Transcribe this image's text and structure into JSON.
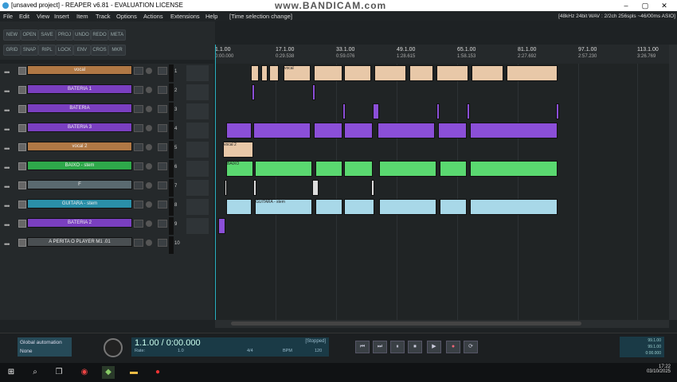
{
  "window": {
    "title": "[unsaved project] - REAPER v6.81 - EVALUATION LICENSE",
    "watermark": "www.BANDICAM.com",
    "controls": [
      "–",
      "▢",
      "✕"
    ]
  },
  "menu": {
    "items": [
      "File",
      "Edit",
      "View",
      "Insert",
      "Item",
      "Track",
      "Options",
      "Actions",
      "Extensions",
      "Help"
    ],
    "last_action": "[Time selection change]",
    "status": "[48kHz 24bit WAV : 2/2ch 256spls ~46/00ms ASIO]"
  },
  "toolbar": {
    "row1": [
      "NEW",
      "OPEN",
      "SAVE",
      "PROJ",
      "UNDO",
      "REDO",
      "META"
    ],
    "row2": [
      "GRID",
      "SNAP",
      "RIPL",
      "LOCK",
      "ENV",
      "CROS",
      "MKR"
    ]
  },
  "ruler": {
    "measures": [
      "1.1.00",
      "17.1.00",
      "33.1.00",
      "49.1.00",
      "65.1.00",
      "81.1.00",
      "97.1.00",
      "113.1.00"
    ],
    "times": [
      "0:00.000",
      "0:29.538",
      "0:59.076",
      "1:28.615",
      "1:58.153",
      "2:27.692",
      "2:57.230",
      "3:26.769"
    ]
  },
  "tracks": [
    {
      "num": "1",
      "name": "vocal",
      "color": "#b07845"
    },
    {
      "num": "2",
      "name": "BATERIA 1",
      "color": "#7a3fc0"
    },
    {
      "num": "3",
      "name": "BATERIA",
      "color": "#7a3fc0"
    },
    {
      "num": "4",
      "name": "BATERIA 3",
      "color": "#7a3fc0"
    },
    {
      "num": "5",
      "name": "vocal 2",
      "color": "#b07845"
    },
    {
      "num": "6",
      "name": "BAIXO - stem",
      "color": "#2ea84a"
    },
    {
      "num": "7",
      "name": "F",
      "color": "#5a6a70"
    },
    {
      "num": "8",
      "name": "GUITARA - stem",
      "color": "#2a8fa8"
    },
    {
      "num": "9",
      "name": "BATERIA 2",
      "color": "#7a3fc0"
    },
    {
      "num": "10",
      "name": "A PERITA O PLAYER M1 .01",
      "color": "#4a4f52"
    }
  ],
  "items": {
    "vocal_label": "vocal",
    "baixo_label": "BAIXO",
    "guitara_label": "GUITARA - stem",
    "vocal2_label": "vocal 2"
  },
  "transport": {
    "automation": "Global automation",
    "automation_mode": "None",
    "position": "1.1.00 / 0:00.000",
    "state": "[Stopped]",
    "rate_label": "Rate:",
    "rate_value": "1.0",
    "ts_label": "4/4",
    "bpm_label": "BPM",
    "bpm_value": "120",
    "buttons": [
      "⏮",
      "⏭",
      "⏸",
      "⏹",
      "▶",
      "●",
      "⟳"
    ],
    "vu_top": "99.1.00",
    "vu_mid": "99.1.00",
    "vu_bot": "0:00.000"
  },
  "taskbar": {
    "time": "17:22",
    "date": "03/10/2025"
  },
  "colors": {
    "purple": "#7a3fc0",
    "green": "#2ea84a",
    "teal": "#2a8fa8",
    "brown": "#b07845",
    "cursor": "#28b0c0"
  }
}
